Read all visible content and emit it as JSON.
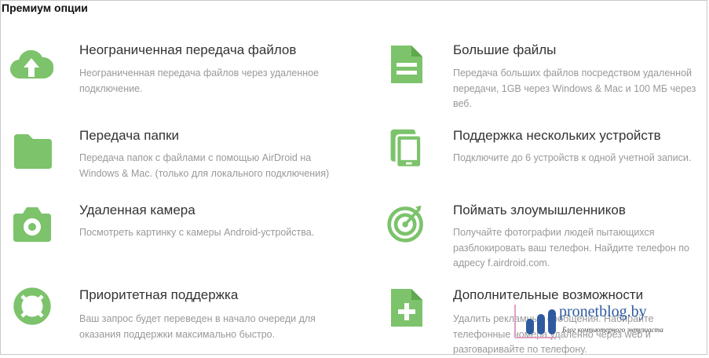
{
  "page": {
    "title": "Премиум опции"
  },
  "features": [
    {
      "name": "unlimited-transfer",
      "icon": "cloud-upload-icon",
      "title": "Неограниченная передача файлов",
      "desc": [
        "Неограниченная передача файлов через удаленное",
        "подключение."
      ]
    },
    {
      "name": "large-files",
      "icon": "document-icon",
      "title": "Большие файлы",
      "desc": [
        "Передача больших файлов посредством удаленной",
        "передачи, 1GB через Windows & Mac и 100 МБ через",
        "веб."
      ]
    },
    {
      "name": "folder-transfer",
      "icon": "folder-icon",
      "title": "Передача папки",
      "desc": [
        "Передача папок с файлами с помощью AirDroid на",
        "Windows & Mac. (только для локального подключения)"
      ]
    },
    {
      "name": "multiple-devices",
      "icon": "devices-icon",
      "title": "Поддержка нескольких устройств",
      "desc": [
        "Подключите до 6 устройств к одной учетной записи."
      ]
    },
    {
      "name": "remote-camera",
      "icon": "camera-icon",
      "title": "Удаленная камера",
      "desc": [
        "Посмотреть картинку с камеры Android-устройства."
      ]
    },
    {
      "name": "catch-intruders",
      "icon": "target-icon",
      "title": "Поймать злоумышленников",
      "desc": [
        "Получайте фотографии людей пытающихся",
        "разблокировать ваш телефон. Найдите телефон по",
        "адресу f.airdroid.com."
      ]
    },
    {
      "name": "priority-support",
      "icon": "lifebuoy-icon",
      "title": "Приоритетная поддержка",
      "desc": [
        "Ваш запрос будет переведен в начало очереди для",
        "оказания поддержки максимально быстро."
      ]
    },
    {
      "name": "extra-features",
      "icon": "add-document-icon",
      "title": "Дополнительные возможности",
      "desc": [
        "Удалить рекламные сообщения. Набирайте",
        "телефонные номера удаленно через web и",
        "разговаривайте по телефону."
      ]
    }
  ],
  "watermark": {
    "text": "pronetblog.by",
    "subtitle": "Блог компьютерного энтузиаста"
  },
  "colors": {
    "icon_green": "#7cc36b",
    "title": "#333333",
    "desc": "#999999"
  }
}
